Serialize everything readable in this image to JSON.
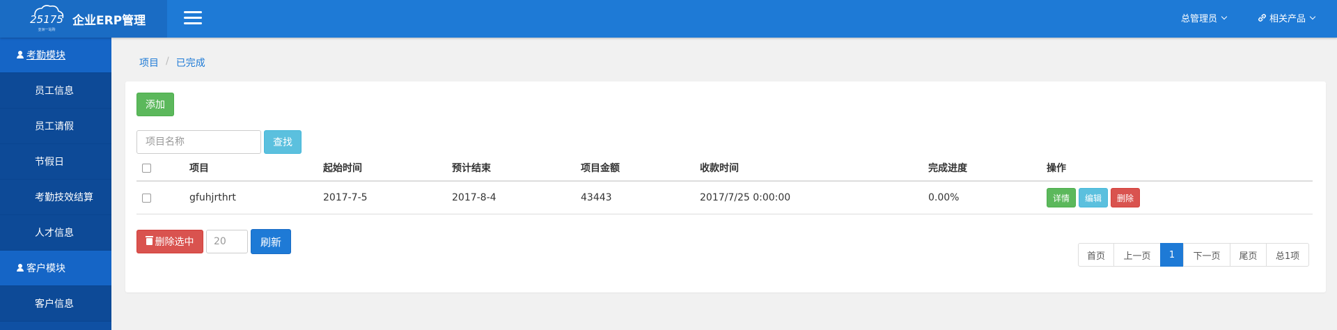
{
  "header": {
    "logo_text": "25175",
    "logo_subtext": "亚洲一站购",
    "title": "企业ERP管理",
    "admin_label": "总管理员",
    "products_label": "相关产品"
  },
  "sidebar": {
    "items": [
      {
        "label": "考勤模块",
        "type": "module"
      },
      {
        "label": "员工信息",
        "type": "sub"
      },
      {
        "label": "员工请假",
        "type": "sub"
      },
      {
        "label": "节假日",
        "type": "sub"
      },
      {
        "label": "考勤技效结算",
        "type": "sub"
      },
      {
        "label": "人才信息",
        "type": "sub"
      },
      {
        "label": "客户模块",
        "type": "module"
      },
      {
        "label": "客户信息",
        "type": "sub"
      }
    ]
  },
  "breadcrumb": {
    "root": "项目",
    "separator": "/",
    "current": "已完成"
  },
  "toolbar": {
    "add_label": "添加",
    "search_placeholder": "项目名称",
    "search_label": "查找"
  },
  "table": {
    "headers": [
      "项目",
      "起始时间",
      "预计结束",
      "项目金额",
      "收款时间",
      "完成进度",
      "操作"
    ],
    "rows": [
      {
        "project": "gfuhjrthrt",
        "start": "2017-7-5",
        "expected_end": "2017-8-4",
        "amount": "43443",
        "payment_time": "2017/7/25 0:00:00",
        "progress": "0.00%",
        "actions": {
          "detail": "详情",
          "edit": "编辑",
          "delete": "删除"
        }
      }
    ]
  },
  "footer": {
    "delete_selected_label": "删除选中",
    "page_size_value": "20",
    "refresh_label": "刷新"
  },
  "pagination": {
    "first": "首页",
    "prev": "上一页",
    "current": "1",
    "next": "下一页",
    "last": "尾页",
    "total": "总1项"
  },
  "colors": {
    "header": "#1e7ad6",
    "sidebar": "#0f50a3",
    "success": "#5cb85c",
    "info": "#5bc0de",
    "danger": "#d9534f"
  }
}
